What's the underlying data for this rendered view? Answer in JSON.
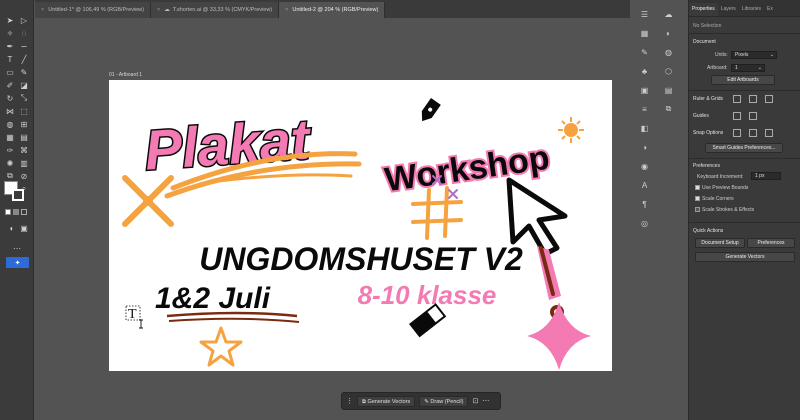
{
  "tabs": [
    {
      "label": "Untitled-1* @ 106,49 % (RGB/Preview)",
      "active": false
    },
    {
      "label": "T.shorten.ai @ 33,33 % (CMYK/Preview)",
      "active": false
    },
    {
      "label": "Untitled-2 @ 204 % (RGB/Preview)",
      "active": true
    }
  ],
  "artboard": {
    "label": "01 - Artboard 1"
  },
  "poster": {
    "title": "Plakat",
    "subtitle": "Workshop",
    "venue": "UNGDOMSHUSET V2",
    "dates": "1&2 Juli",
    "grades": "8-10 klasse",
    "colors": {
      "pink": "#f47ab4",
      "black": "#0a0a0a",
      "orange": "#f4a340",
      "purple": "#b46cc4",
      "brown": "#7a2a10"
    }
  },
  "context_bar": {
    "generate": "Generate Vectors",
    "draw": "Draw (Pencil)"
  },
  "panel": {
    "tabs": [
      "Properties",
      "Layers",
      "Libraries"
    ],
    "tab_partial": "Ex",
    "no_selection": "No Selection",
    "document": "Document",
    "units_label": "Units:",
    "units_value": "Pixels",
    "artboard_label": "Artboard:",
    "artboard_value": "1",
    "edit_artboards": "Edit Artboards",
    "rulers": "Ruler & Grids",
    "guides": "Guides",
    "snap": "Snap Options",
    "smart_guides": "Smart Guides Preferences...",
    "preferences": "Preferences",
    "keyboard_label": "Keyboard Increment:",
    "keyboard_value": "1 px",
    "chk_preview": "Use Preview Bounds",
    "chk_corners": "Scale Corners",
    "chk_strokes": "Scale Strokes & Effects",
    "quick_actions": "Quick Actions",
    "doc_setup": "Document Setup",
    "prefs_btn": "Preferences",
    "generate_vectors": "Generate Vectors"
  }
}
